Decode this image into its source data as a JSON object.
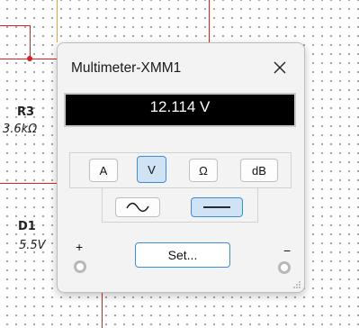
{
  "schematic": {
    "r3": {
      "name": "R3",
      "value": "3.6kΩ"
    },
    "d1": {
      "name": "D1",
      "value": "5.5V"
    }
  },
  "window": {
    "title": "Multimeter-XMM1",
    "close_icon": "close-icon"
  },
  "display": {
    "reading": "12.114 V"
  },
  "modes": [
    {
      "label": "A",
      "active": false
    },
    {
      "label": "V",
      "active": true
    },
    {
      "label": "Ω",
      "active": false
    },
    {
      "label": "dB",
      "active": false
    }
  ],
  "signal": [
    {
      "icon": "ac-wave-icon",
      "active": false
    },
    {
      "icon": "dc-line-icon",
      "active": true
    }
  ],
  "terminals": {
    "plus": "+",
    "minus": "−"
  },
  "set_button": {
    "label": "Set..."
  },
  "colors": {
    "accent": "#3c8ed6",
    "active_bg": "#cfe3f5",
    "wire_red": "#e02020",
    "wire_orange": "#f0a030"
  }
}
